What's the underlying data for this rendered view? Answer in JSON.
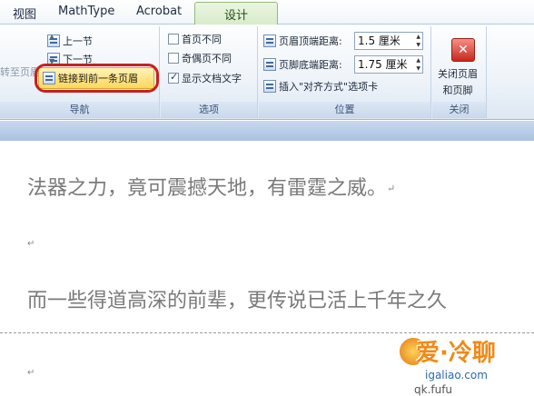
{
  "tabs": [
    {
      "label": "视图",
      "active": false
    },
    {
      "label": "MathType",
      "active": false
    },
    {
      "label": "Acrobat",
      "active": false
    },
    {
      "label": "设计",
      "active": true
    }
  ],
  "ribbon": {
    "nav": {
      "goto_partial": "转至页眉",
      "prev_section": "上一节",
      "next_section": "下一节",
      "link_previous": "链接到前一条页眉",
      "label": "导航"
    },
    "options": {
      "first_page_diff": {
        "label": "首页不同",
        "checked": false
      },
      "odd_even_diff": {
        "label": "奇偶页不同",
        "checked": false
      },
      "show_doc_text": {
        "label": "显示文档文字",
        "checked": true
      },
      "label": "选项"
    },
    "position": {
      "header_top_label": "页眉顶端距离:",
      "header_top_value": "1.5 厘米",
      "footer_bottom_label": "页脚底端距离:",
      "footer_bottom_value": "1.75 厘米",
      "insert_align_tab": "插入\"对齐方式\"选项卡",
      "label": "位置"
    },
    "close": {
      "button_line1": "关闭页眉",
      "button_line2": "和页脚",
      "label": "关闭"
    }
  },
  "document": {
    "line1": "法器之力，竟可震撼天地，有雷霆之威。",
    "line2": "而一些得道高深的前辈，更传说已活上千年之久"
  },
  "watermark": {
    "big": "爱·冷聊",
    "site": "igaliao.com",
    "sub": "qk.fufu"
  },
  "colors": {
    "accent_tab": "#d7ebc8",
    "highlight_ring": "#c62020",
    "link_button": "#ffd75a"
  }
}
